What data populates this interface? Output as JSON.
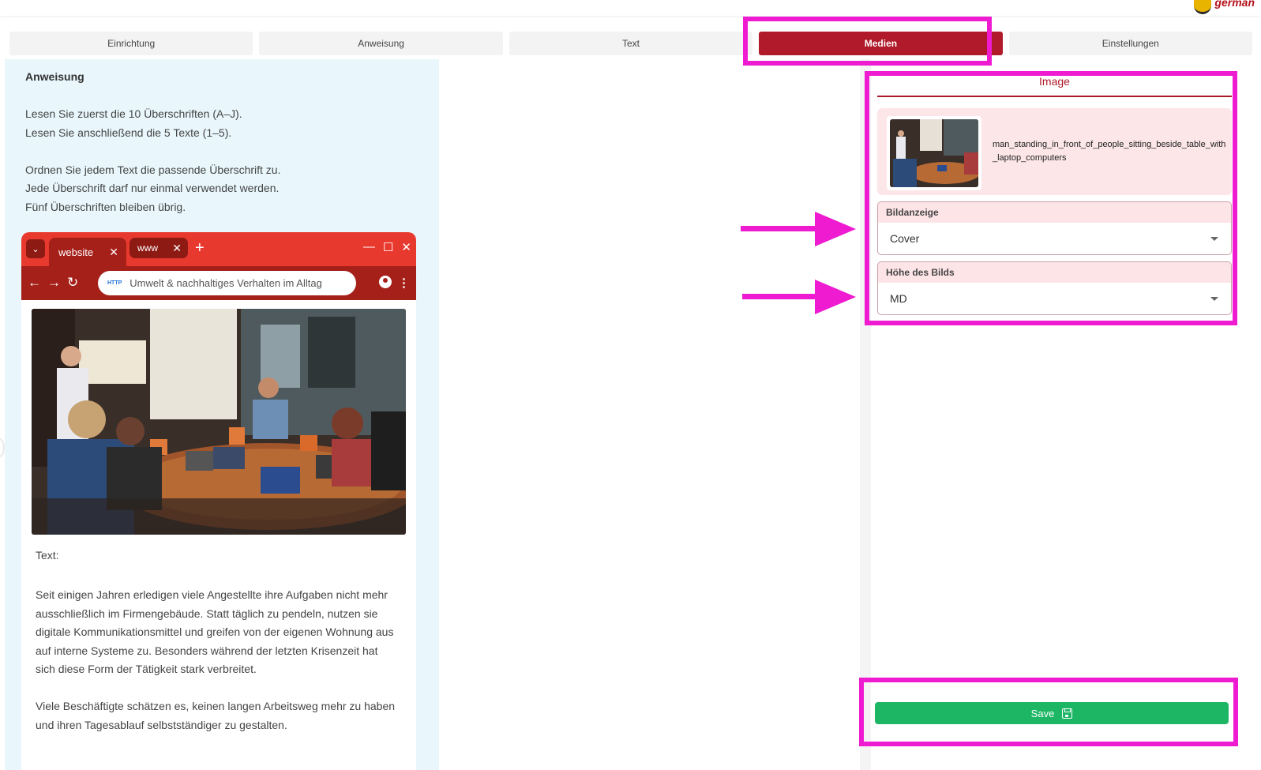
{
  "brand": {
    "logo_text": "german"
  },
  "tabs": [
    {
      "label": "Einrichtung"
    },
    {
      "label": "Anweisung"
    },
    {
      "label": "Text"
    },
    {
      "label": "Medien"
    },
    {
      "label": "Einstellungen"
    }
  ],
  "instruction": {
    "title": "Anweisung",
    "text": "Lesen Sie zuerst die 10 Überschriften (A–J).\nLesen Sie anschließend die 5 Texte (1–5).\n\nOrdnen Sie jedem Text die passende Überschrift zu.\nJede Überschrift darf nur einmal verwendet werden.\nFünf Überschriften bleiben übrig."
  },
  "browser": {
    "tab1": "website",
    "tab2": "www",
    "url_badge": "HTTP",
    "url_text": "Umwelt & nachhaltiges Verhalten im Alltag"
  },
  "content": {
    "text_label": "Text:",
    "paragraph1": "Seit einigen Jahren erledigen viele Angestellte ihre Aufgaben nicht mehr ausschließlich im Firmengebäude. Statt täglich zu pendeln, nutzen sie digitale Kommunikationsmittel und greifen von der eigenen Wohnung aus auf interne Systeme zu. Besonders während der letzten Krisenzeit hat sich diese Form der Tätigkeit stark verbreitet.",
    "paragraph2": "Viele Beschäftigte schätzen es, keinen langen Arbeitsweg mehr zu haben und ihren Tagesablauf selbstständiger zu gestalten."
  },
  "media": {
    "header": "Image",
    "filename": "man_standing_in_front_of_people_sitting_beside_table_with_laptop_computers",
    "display_label": "Bildanzeige",
    "display_value": "Cover",
    "height_label": "Höhe des Bilds",
    "height_value": "MD"
  },
  "actions": {
    "save_label": "Save"
  },
  "colors": {
    "accent": "#b01a2a",
    "highlight": "#ee1bd1",
    "save": "#1db665",
    "panel": "#e9f7fc"
  }
}
